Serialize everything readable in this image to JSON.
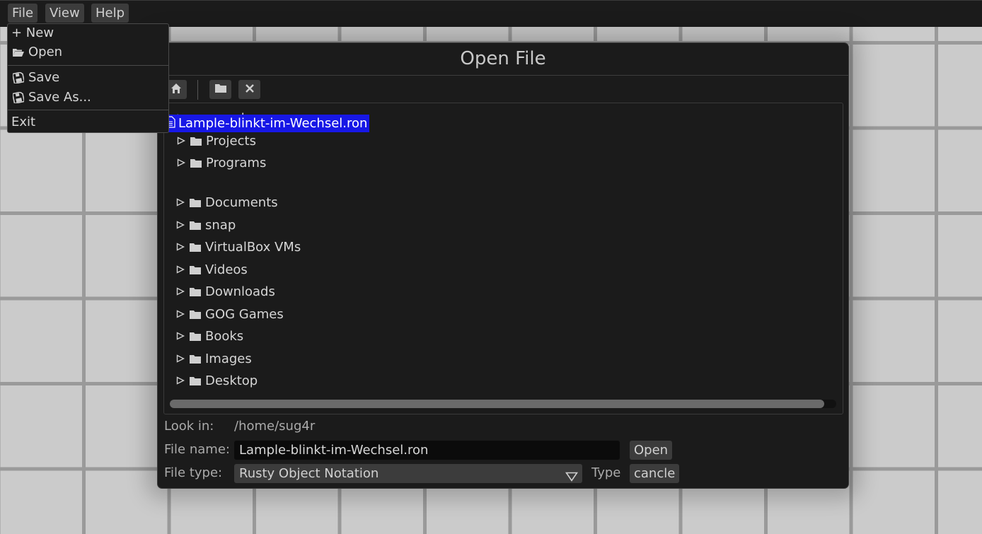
{
  "menubar": {
    "file_label": "File",
    "view_label": "View",
    "help_label": "Help"
  },
  "file_menu": {
    "new_label": "+ New",
    "open_label": "Open",
    "save_label": "Save",
    "save_as_label": "Save As...",
    "exit_label": "Exit"
  },
  "dialog": {
    "title": "Open File",
    "toolbar_icons": [
      "home-icon",
      "folder-icon",
      "close-icon"
    ],
    "tree": {
      "items_before": [
        "snapd",
        "Projects",
        "Programs"
      ],
      "selected_file": "Lample-blinkt-im-Wechsel.ron",
      "items_after": [
        "Documents",
        "snap",
        "VirtualBox VMs",
        "Videos",
        "Downloads",
        "GOG Games",
        "Books",
        "Images",
        "Desktop"
      ]
    },
    "look_in_label": "Look in:",
    "look_in_value": "/home/sug4r",
    "file_name_label": "File name:",
    "file_name_value": "Lample-blinkt-im-Wechsel.ron",
    "file_type_label": "File type:",
    "file_type_value": "Rusty Object Notation",
    "type_label": "Type",
    "open_button": "Open",
    "cancel_button": "cancle"
  },
  "colors": {
    "selection": "#1717e6",
    "panel": "#1b1b1b",
    "button": "#3c3c3c"
  }
}
